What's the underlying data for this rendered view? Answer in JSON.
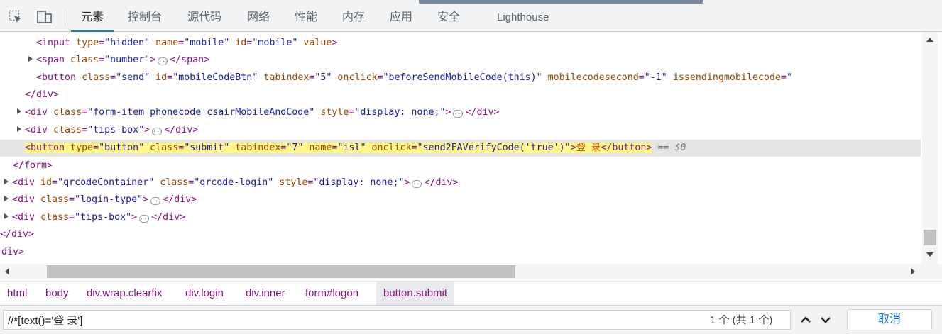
{
  "toolbar": {
    "icons": [
      "inspect-element-icon",
      "device-toolbar-icon"
    ],
    "tabs": [
      {
        "label": "元素",
        "active": true
      },
      {
        "label": "控制台"
      },
      {
        "label": "源代码"
      },
      {
        "label": "网络"
      },
      {
        "label": "性能"
      },
      {
        "label": "内存"
      },
      {
        "label": "应用"
      },
      {
        "label": "安全"
      },
      {
        "label": "Lighthouse"
      }
    ]
  },
  "dom": {
    "l1": {
      "open": "<input",
      "a1n": "type",
      "a1v": "\"hidden\"",
      "a2n": "name",
      "a2v": "\"mobile\"",
      "a3n": "id",
      "a3v": "\"mobile\"",
      "a4n": "value",
      "close": ">"
    },
    "l2": {
      "open": "<span",
      "a1n": "class",
      "a1v": "\"number\"",
      "mid": ">",
      "close": "</span>"
    },
    "l3": {
      "open": "<button",
      "a1n": "class",
      "a1v": "\"send\"",
      "a2n": "id",
      "a2v": "\"mobileCodeBtn\"",
      "a3n": "tabindex",
      "a3v": "\"5\"",
      "a4n": "onclick",
      "a4v": "\"beforeSendMobileCode(this)\"",
      "a5n": "mobilecodesecond",
      "a5v": "\"-1\"",
      "a6n": "issendingmobilecode",
      "a6v": "\""
    },
    "l4": {
      "close": "</div>"
    },
    "l5": {
      "open": "<div",
      "a1n": "class",
      "a1v": "\"form-item phonecode csairMobileAndCode\"",
      "a2n": "style",
      "a2v": "\"display: none;\"",
      "mid": ">",
      "close": "</div>"
    },
    "l6": {
      "open": "<div",
      "a1n": "class",
      "a1v": "\"tips-box\"",
      "mid": ">",
      "close": "</div>"
    },
    "l7": {
      "open": "<button",
      "a1n": "type",
      "a1v": "\"button\"",
      "a2n": "class",
      "a2v": "\"submit\"",
      "a3n": "tabindex",
      "a3v": "\"7\"",
      "a4n": "name",
      "a4v": "\"isl\"",
      "a5n": "onclick",
      "a5v": "\"send2FAVerifyCode('true')\"",
      "mid": ">",
      "text": "登 录",
      "close": "</button>",
      "marker": "== $0"
    },
    "l8": {
      "close": "</form>"
    },
    "l9": {
      "open": "<div",
      "a1n": "id",
      "a1v": "\"qrcodeContainer\"",
      "a2n": "class",
      "a2v": "\"qrcode-login\"",
      "a3n": "style",
      "a3v": "\"display: none;\"",
      "mid": ">",
      "close": "</div>"
    },
    "l10": {
      "open": "<div",
      "a1n": "class",
      "a1v": "\"login-type\"",
      "mid": ">",
      "close": "</div>"
    },
    "l11": {
      "open": "<div",
      "a1n": "class",
      "a1v": "\"tips-box\"",
      "mid": ">",
      "close": "</div>"
    },
    "l12": {
      "close": "</div>"
    },
    "l13": {
      "close": "div>"
    }
  },
  "breadcrumbs": [
    "html",
    "body",
    "div.wrap.clearfix",
    "div.login",
    "div.inner",
    "form#logon",
    "button.submit"
  ],
  "search": {
    "value": "//*[text()='登 录']",
    "count": "1 个 (共 1 个)",
    "cancel_label": "取消"
  },
  "colors": {
    "tag": "#881280",
    "attr_name": "#994500",
    "attr_value": "#1a1aa6",
    "highlight": "#fff78a",
    "accent": "#1a73e8"
  }
}
